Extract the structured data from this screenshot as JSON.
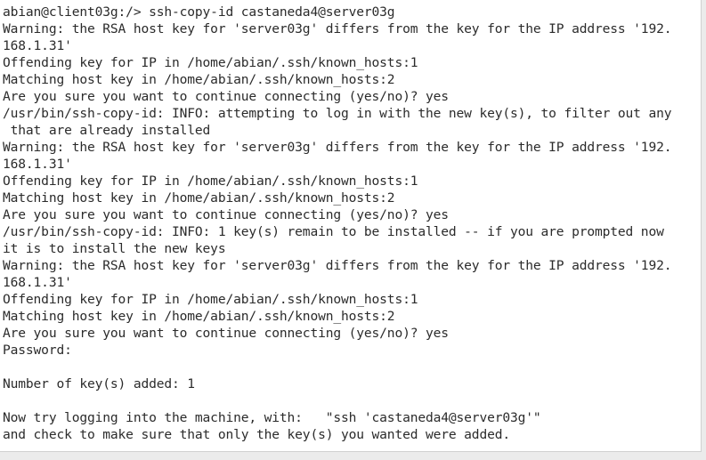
{
  "terminal": {
    "lines": [
      "abian@client03g:/> ssh-copy-id castaneda4@server03g",
      "Warning: the RSA host key for 'server03g' differs from the key for the IP address '192.",
      "168.1.31'",
      "Offending key for IP in /home/abian/.ssh/known_hosts:1",
      "Matching host key in /home/abian/.ssh/known_hosts:2",
      "Are you sure you want to continue connecting (yes/no)? yes",
      "/usr/bin/ssh-copy-id: INFO: attempting to log in with the new key(s), to filter out any",
      " that are already installed",
      "Warning: the RSA host key for 'server03g' differs from the key for the IP address '192.",
      "168.1.31'",
      "Offending key for IP in /home/abian/.ssh/known_hosts:1",
      "Matching host key in /home/abian/.ssh/known_hosts:2",
      "Are you sure you want to continue connecting (yes/no)? yes",
      "/usr/bin/ssh-copy-id: INFO: 1 key(s) remain to be installed -- if you are prompted now",
      "it is to install the new keys",
      "Warning: the RSA host key for 'server03g' differs from the key for the IP address '192.",
      "168.1.31'",
      "Offending key for IP in /home/abian/.ssh/known_hosts:1",
      "Matching host key in /home/abian/.ssh/known_hosts:2",
      "Are you sure you want to continue connecting (yes/no)? yes",
      "Password:",
      "",
      "Number of key(s) added: 1",
      "",
      "Now try logging into the machine, with:   \"ssh 'castaneda4@server03g'\"",
      "and check to make sure that only the key(s) you wanted were added."
    ]
  }
}
